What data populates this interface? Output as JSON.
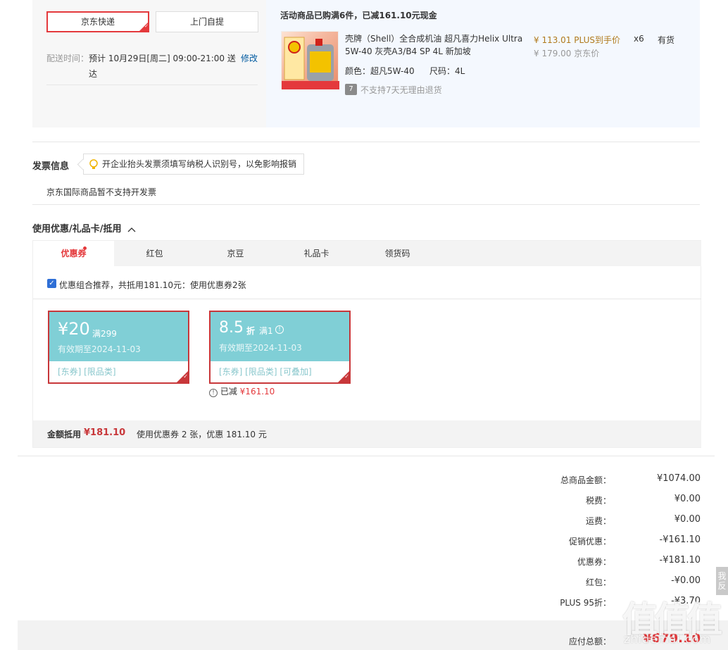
{
  "shipping": {
    "option_jd": "京东快递",
    "option_pickup": "上门自提",
    "time_label": "配送时间：",
    "time_value_line1": "预计 10月29日[周二] 09:00-21:00 送",
    "time_value_line2": "达",
    "modify": "修改"
  },
  "promo_header": "活动商品已购满6件，已减161.10元现金",
  "product": {
    "name_line1": "壳牌（Shell）全合成机油 超凡喜力Helix Ultra",
    "name_line2": "5W-40 灰壳A3/B4 SP 4L 新加坡",
    "price_plus": "¥ 113.01 PLUS到手价",
    "price_jd": "¥ 179.00 京东价",
    "qty": "x6",
    "stock": "有货",
    "color_label": "颜色：",
    "color_value": "超凡5W-40",
    "size_label": "尺码：",
    "size_value": "4L",
    "return_badge": "7",
    "return_note": "不支持7天无理由退货"
  },
  "invoice": {
    "title": "发票信息",
    "tip": "开企业抬头发票须填写纳税人识别号，以免影响报销",
    "note": "京东国际商品暂不支持开发票"
  },
  "discount_section": {
    "title": "使用优惠/礼品卡/抵用",
    "tabs": [
      "优惠券",
      "红包",
      "京豆",
      "礼品卡",
      "领货码"
    ],
    "combo_text": "优惠组合推荐，共抵用181.10元：使用优惠券2张",
    "coupons": [
      {
        "amount": "¥20",
        "condition": "满299",
        "expiry": "有效期至2024-11-03",
        "tags": "[东券]  [限品类]"
      },
      {
        "amount": "8.5",
        "unit": "折",
        "condition": "满1",
        "expiry": "有效期至2024-11-03",
        "tags": "[东券]  [限品类]  [可叠加]"
      }
    ],
    "reduced_label": "已减",
    "reduced_value": "¥161.10",
    "footer_label": "金额抵用",
    "footer_amount": "¥181.10",
    "footer_desc": "使用优惠券 2 张，优惠 181.10 元"
  },
  "summary": {
    "rows": [
      {
        "label": "总商品金额：",
        "value": "¥1074.00"
      },
      {
        "label": "税费：",
        "value": "¥0.00"
      },
      {
        "label": "运费：",
        "value": "¥0.00"
      },
      {
        "label": "促销优惠：",
        "value": "-¥161.10"
      },
      {
        "label": "优惠券：",
        "value": "-¥181.10"
      },
      {
        "label": "红包：",
        "value": "-¥0.00"
      },
      {
        "label": "PLUS 95折：",
        "value": "-¥3.70"
      }
    ],
    "total_label": "应付总额：",
    "total_value": "¥679.10"
  },
  "side_tab": "我反",
  "watermark": "值值值",
  "watermark_url": "zhidemai.com",
  "colors": {
    "accent": "#e4393c",
    "coupon_teal": "#80cfd6",
    "link": "#005aa0"
  }
}
